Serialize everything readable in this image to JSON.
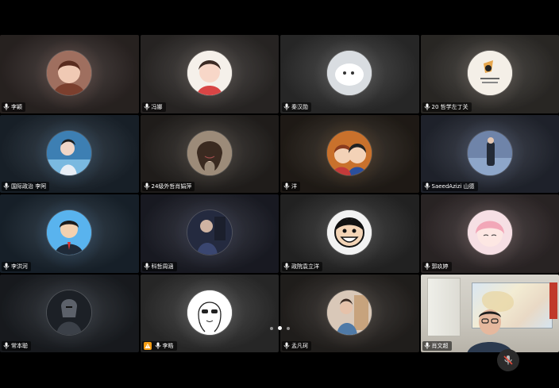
{
  "participants": [
    {
      "name": "李颖",
      "bg": "#3b3230",
      "glow": "#7a5a52",
      "av": "#caa79a"
    },
    {
      "name": "冯娜",
      "bg": "#3a3634",
      "glow": "#6b625c",
      "av": "#efe6e0"
    },
    {
      "name": "秦汉勋",
      "bg": "#3b3b3b",
      "glow": "#6f6f6f",
      "av": "#e3e5e7"
    },
    {
      "name": "20 哲学左丁关",
      "bg": "#3d3a36",
      "glow": "#7b7168",
      "av": "#f4efe7"
    },
    {
      "name": "国际政治 李阿",
      "bg": "#24303c",
      "glow": "#3b5f7c",
      "av": "#4e87b6"
    },
    {
      "name": "24级外哲肖娟萍",
      "bg": "#2f2b28",
      "glow": "#5c5349",
      "av": "#b8a792"
    },
    {
      "name": "洋",
      "bg": "#2e2720",
      "glow": "#6a4a2a",
      "av": "#d37a2f"
    },
    {
      "name": "SaeedAzizi 山德",
      "bg": "#2e3340",
      "glow": "#52607c",
      "av": "#5c6d90"
    },
    {
      "name": "李洪河",
      "bg": "#22303d",
      "glow": "#3d6387",
      "av": "#5aa9e0"
    },
    {
      "name": "科哲周涵",
      "bg": "#252733",
      "glow": "#3a4058",
      "av": "#2f3450"
    },
    {
      "name": "政院袁立洋",
      "bg": "#333333",
      "glow": "#5c5c5c",
      "av": "#efefef"
    },
    {
      "name": "郭玖婷",
      "bg": "#3e3536",
      "glow": "#806a6a",
      "av": "#f1c8cf"
    },
    {
      "name": "常本聪",
      "bg": "#23272d",
      "glow": "#3f4650",
      "av": "#2a2f36"
    },
    {
      "name": "李皓",
      "bg": "#3a3a3a",
      "glow": "#777777",
      "av": "#ffffff"
    },
    {
      "name": "孟凡珂",
      "bg": "#302c29",
      "glow": "#5f554d",
      "av": "#b6a597"
    },
    {
      "name": "肖文超",
      "bg": "#c9c6bd",
      "glow": "#ffffff",
      "av": "#c9c6bd"
    }
  ],
  "icons": {
    "mic": "mic-icon",
    "warning": "warning-icon",
    "mute": "mic-muted-icon"
  },
  "pagination": {
    "pages": 3,
    "current": 2
  }
}
